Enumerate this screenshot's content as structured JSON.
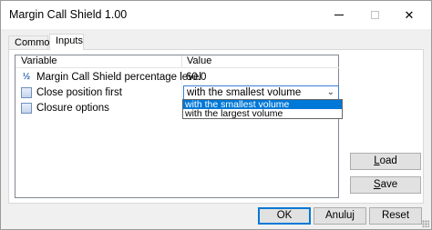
{
  "window": {
    "title": "Margin Call Shield 1.00",
    "controls": {
      "minimize": "minimize",
      "maximize": "maximize",
      "close": "✕"
    }
  },
  "tabs": [
    {
      "label": "Common",
      "active": false
    },
    {
      "label": "Inputs",
      "active": true
    }
  ],
  "grid": {
    "headers": {
      "variable": "Variable",
      "value": "Value"
    },
    "rows": [
      {
        "icon": "fraction-icon",
        "icon_glyph": "½",
        "variable": "Margin Call Shield percentage level",
        "value": "60.0"
      },
      {
        "icon": "enum-list-icon",
        "variable": "Close position first",
        "value": "with the smallest volume"
      },
      {
        "icon": "enum-list-icon",
        "variable": "Closure options",
        "value": ""
      }
    ]
  },
  "dropdown": {
    "options": [
      {
        "label": "with the smallest volume",
        "selected": true
      },
      {
        "label": "with the largest volume",
        "selected": false
      }
    ],
    "arrow": "⌄"
  },
  "buttons": {
    "load_first": "L",
    "load_rest": "oad",
    "save_first": "S",
    "save_rest": "ave",
    "ok": "OK",
    "cancel": "Anuluj",
    "reset": "Reset"
  },
  "colors": {
    "accent": "#0078d7",
    "selection": "#0078d7",
    "button_face": "#e1e1e1"
  }
}
